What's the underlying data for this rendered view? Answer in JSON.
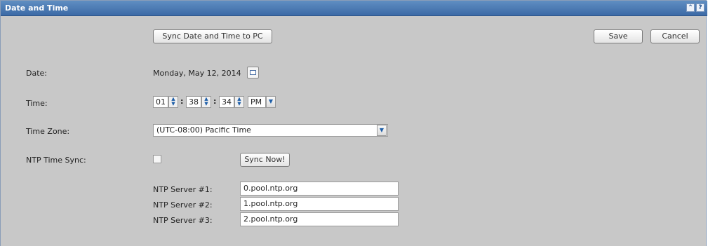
{
  "window": {
    "title": "Date and Time"
  },
  "toolbar": {
    "sync_pc_label": "Sync Date and Time to PC",
    "save_label": "Save",
    "cancel_label": "Cancel"
  },
  "date": {
    "label": "Date:",
    "value": "Monday, May 12, 2014"
  },
  "time": {
    "label": "Time:",
    "hour": "01",
    "minute": "38",
    "second": "34",
    "ampm": "PM"
  },
  "timezone": {
    "label": "Time Zone:",
    "value": "(UTC-08:00) Pacific Time"
  },
  "ntp": {
    "label": "NTP Time Sync:",
    "checked": false,
    "sync_now_label": "Sync Now!",
    "servers": [
      {
        "label": "NTP Server #1:",
        "value": "0.pool.ntp.org"
      },
      {
        "label": "NTP Server #2:",
        "value": "1.pool.ntp.org"
      },
      {
        "label": "NTP Server #3:",
        "value": "2.pool.ntp.org"
      }
    ]
  },
  "icons": {
    "collapse": "collapse-icon",
    "help": "help-icon",
    "calendar": "calendar-icon",
    "spinner": "spinner-icon",
    "dropdown": "chevron-down-icon"
  },
  "colors": {
    "titlebar": "#4a7ab5",
    "panel": "#c8c8c8"
  }
}
